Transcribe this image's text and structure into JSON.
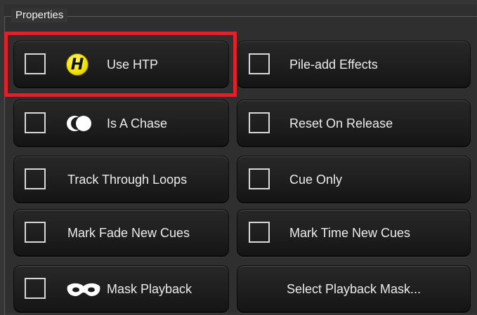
{
  "group": {
    "title": "Properties"
  },
  "buttons": {
    "use_htp": {
      "label": "Use HTP",
      "icon_text": "H",
      "checked": false
    },
    "pile_add_effects": {
      "label": "Pile-add Effects",
      "checked": false
    },
    "is_a_chase": {
      "label": "Is A Chase",
      "checked": false
    },
    "reset_on_release": {
      "label": "Reset On Release",
      "checked": false
    },
    "track_through_loops": {
      "label": "Track Through Loops",
      "checked": false
    },
    "cue_only": {
      "label": "Cue Only",
      "checked": false
    },
    "mark_fade_new_cues": {
      "label": "Mark Fade New Cues",
      "checked": false
    },
    "mark_time_new_cues": {
      "label": "Mark Time New Cues",
      "checked": false
    },
    "mask_playback": {
      "label": "Mask Playback",
      "checked": false
    },
    "select_playback_mask": {
      "label": "Select Playback Mask..."
    }
  },
  "icons": {
    "use_htp": "htp-icon",
    "is_a_chase": "chase-icon",
    "mask_playback": "mask-icon"
  },
  "colors": {
    "highlight": "#e3202a",
    "htp_badge": "#f2e100",
    "background": "#353535"
  }
}
